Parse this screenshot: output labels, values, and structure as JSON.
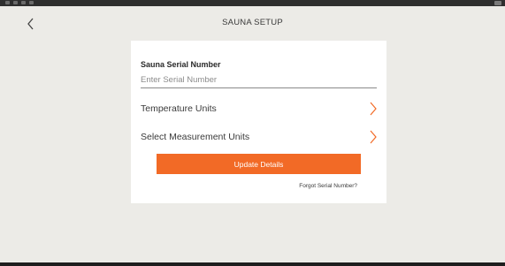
{
  "header": {
    "title": "SAUNA SETUP"
  },
  "form": {
    "serial_label": "Sauna Serial Number",
    "serial_placeholder": "Enter Serial Number",
    "serial_value": "",
    "temperature_units_label": "Temperature Units",
    "measurement_units_label": "Select Measurement Units",
    "update_button_label": "Update Details",
    "forgot_link_label": "Forgot Serial Number?"
  },
  "icons": {
    "back": "back-chevron-icon",
    "row_chevron": "chevron-right-icon"
  },
  "colors": {
    "background": "#ecebe7",
    "card": "#ffffff",
    "accent": "#f26a26",
    "status_bar": "#2e2e2e"
  }
}
